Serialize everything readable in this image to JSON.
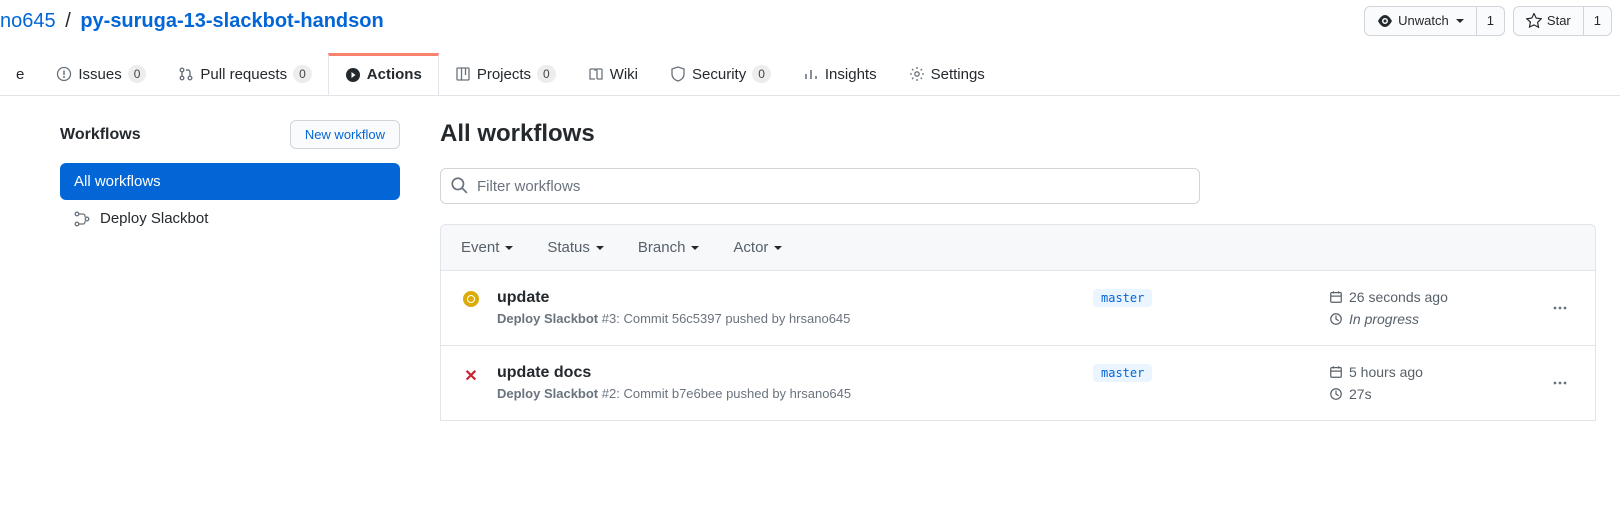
{
  "breadcrumb": {
    "owner": "no645",
    "repo": "py-suruga-13-slackbot-handson",
    "sep": "/"
  },
  "header": {
    "unwatch": "Unwatch",
    "watch_count": "1",
    "star": "Star",
    "star_count": "1"
  },
  "tabs": {
    "code": "e",
    "issues": {
      "label": "Issues",
      "count": "0"
    },
    "pulls": {
      "label": "Pull requests",
      "count": "0"
    },
    "actions": "Actions",
    "projects": {
      "label": "Projects",
      "count": "0"
    },
    "wiki": "Wiki",
    "security": {
      "label": "Security",
      "count": "0"
    },
    "insights": "Insights",
    "settings": "Settings"
  },
  "sidebar": {
    "title": "Workflows",
    "new_workflow": "New workflow",
    "items": [
      "All workflows",
      "Deploy Slackbot"
    ]
  },
  "content": {
    "title": "All workflows",
    "filter_placeholder": "Filter workflows",
    "table_filters": [
      "Event",
      "Status",
      "Branch",
      "Actor"
    ]
  },
  "runs": [
    {
      "title": "update",
      "workflow": "Deploy Slackbot",
      "run_num": "#3",
      "detail": ": Commit 56c5397 pushed by hrsano645",
      "branch": "master",
      "time": "26 seconds ago",
      "duration": "In progress",
      "status": "inprogress"
    },
    {
      "title": "update docs",
      "workflow": "Deploy Slackbot",
      "run_num": "#2",
      "detail": ": Commit b7e6bee pushed by hrsano645",
      "branch": "master",
      "time": "5 hours ago",
      "duration": "27s",
      "status": "fail"
    }
  ]
}
